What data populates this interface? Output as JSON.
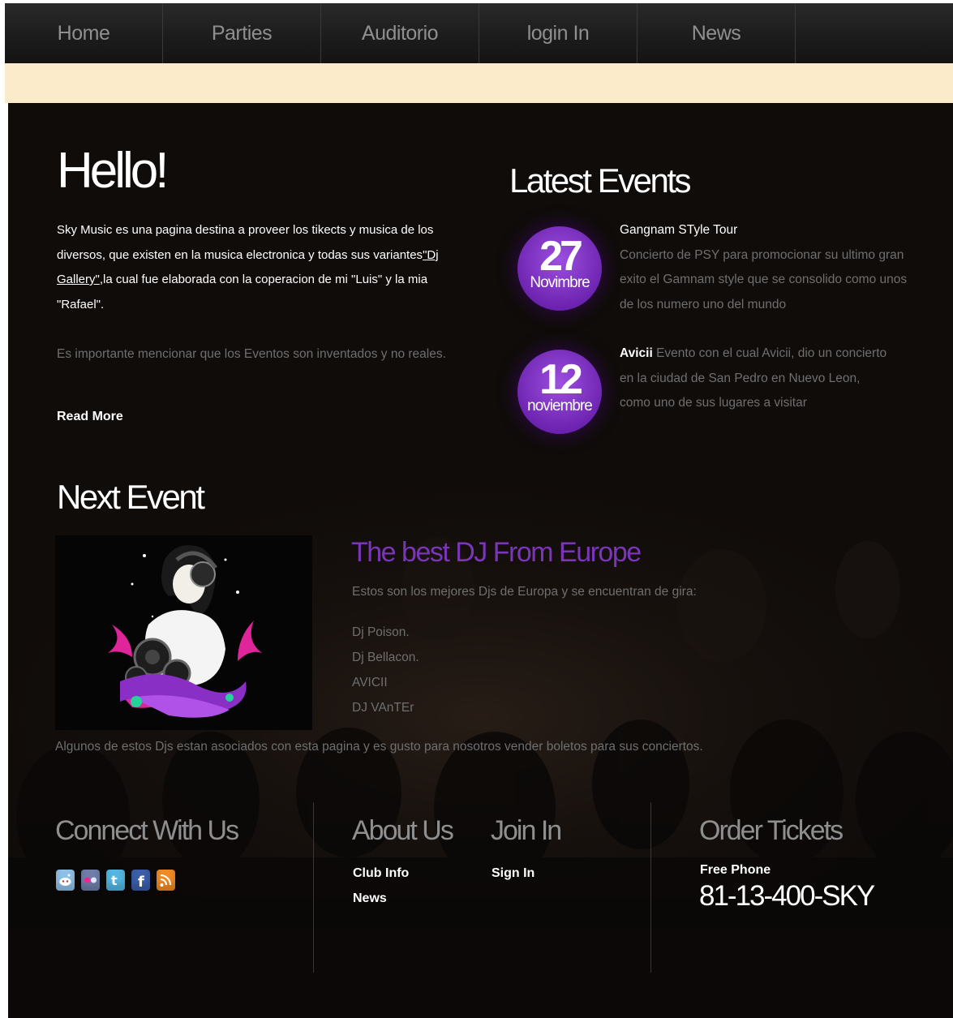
{
  "nav": {
    "items": [
      "Home",
      "Parties",
      "Auditorio",
      "login In",
      "News"
    ]
  },
  "intro": {
    "title": "Hello!",
    "text_part1": "Sky Music es una pagina destina a proveer los tikects y musica de los diversos, que existen en la musica electronica y todas sus variantes",
    "link": "\"Dj Gallery\"",
    "text_part2": ",la cual fue elaborada con la coperacion de mi \"Luis\" y la mia \"Rafael\".",
    "note": "Es importante mencionar que los Eventos son inventados y no reales.",
    "read_more": "Read More"
  },
  "latest_events": {
    "title": "Latest Events",
    "events": [
      {
        "day": "27",
        "month": "Novimbre",
        "name": "Gangnam STyle Tour",
        "description": "Concierto de PSY para promocionar su ultimo gran exito el Gamnam style que se consolido como unos de los numero uno del mundo"
      },
      {
        "day": "12",
        "month": "noviembre",
        "name": "Avicii",
        "description": "Evento con el cual Avicii, dio un concierto en la ciudad de San Pedro en Nuevo Leon, como uno de sus lugares a visitar"
      }
    ]
  },
  "next_event": {
    "title": "Next Event",
    "headline": "The best DJ From Europe",
    "intro": "Estos son los mejores Djs de Europa y se encuentran de gira:",
    "djs": [
      "Dj Poison.",
      "Dj Bellacon.",
      "AVICII",
      "DJ VAnTEr"
    ],
    "footer_text": "Algunos de estos Djs estan asociados con esta pagina y es gusto para nosotros vender boletos para sus conciertos."
  },
  "footer": {
    "connect": {
      "title": "Connect With Us",
      "icons": [
        "reddit-icon",
        "flickr-icon",
        "twitter-icon",
        "facebook-icon",
        "rss-icon"
      ]
    },
    "about": {
      "title": "About Us",
      "links": [
        "Club Info",
        "News"
      ]
    },
    "join": {
      "title": "Join In",
      "links": [
        "Sign In"
      ]
    },
    "order": {
      "title": "Order Tickets",
      "phone_label": "Free Phone",
      "phone": "81-13-400-SKY"
    }
  },
  "colors": {
    "accent_purple": "#7a35b8",
    "background": "#100c0a",
    "cream_band": "#fbebcb"
  }
}
